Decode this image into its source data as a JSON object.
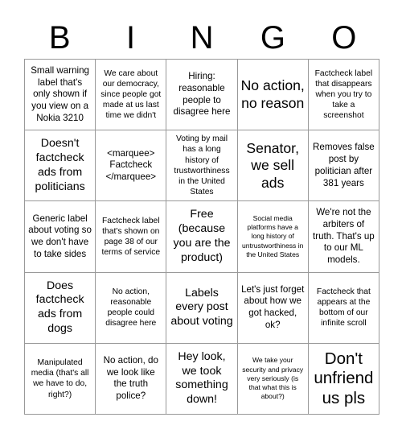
{
  "header": {
    "letters": [
      "B",
      "I",
      "N",
      "G",
      "O"
    ]
  },
  "grid": {
    "columns": 5,
    "rows": 5,
    "border_color": "#999999",
    "text_color": "#000000",
    "background_color": "#ffffff"
  },
  "cells": [
    {
      "text": "Small warning label that's only shown if you view on a Nokia 3210",
      "size": "m"
    },
    {
      "text": "We care about our democracy, since people got made at us last time we didn't",
      "size": "s"
    },
    {
      "text": "Hiring: reasonable people to disagree here",
      "size": "m"
    },
    {
      "text": "No action, no reason",
      "size": "xl"
    },
    {
      "text": "Factcheck label that disappears when you try to take a screenshot",
      "size": "s"
    },
    {
      "text": "Doesn't factcheck ads from politicians",
      "size": "l"
    },
    {
      "text": "<marquee> Factcheck </marquee>",
      "size": "m"
    },
    {
      "text": "Voting by mail has a long history of trustworthiness in the United States",
      "size": "s"
    },
    {
      "text": "Senator, we sell ads",
      "size": "xl"
    },
    {
      "text": "Removes false post by politician after 381 years",
      "size": "m"
    },
    {
      "text": "Generic label about voting so we don't have to take sides",
      "size": "m"
    },
    {
      "text": "Factcheck label that's shown on page 38 of our terms of service",
      "size": "s"
    },
    {
      "text": "Free (because you are the product)",
      "size": "l"
    },
    {
      "text": "Social media platforms have a long history of untrustworthiness in the United States",
      "size": "xs"
    },
    {
      "text": "We're not the arbiters of truth. That's up to our ML models.",
      "size": "m"
    },
    {
      "text": "Does factcheck ads from dogs",
      "size": "l"
    },
    {
      "text": "No action, reasonable people could disagree here",
      "size": "s"
    },
    {
      "text": "Labels every post about voting",
      "size": "l"
    },
    {
      "text": "Let's just forget about how we got hacked, ok?",
      "size": "m"
    },
    {
      "text": "Factcheck that appears at the bottom of our infinite scroll",
      "size": "s"
    },
    {
      "text": "Manipulated media (that's all we have to do, right?)",
      "size": "s"
    },
    {
      "text": "No action, do we look like the truth police?",
      "size": "m"
    },
    {
      "text": "Hey look, we took something down!",
      "size": "l"
    },
    {
      "text": "We take your security and privacy very seriously (is that what this is about?)",
      "size": "xs"
    },
    {
      "text": "Don't unfriend us pls",
      "size": "xxl"
    }
  ]
}
